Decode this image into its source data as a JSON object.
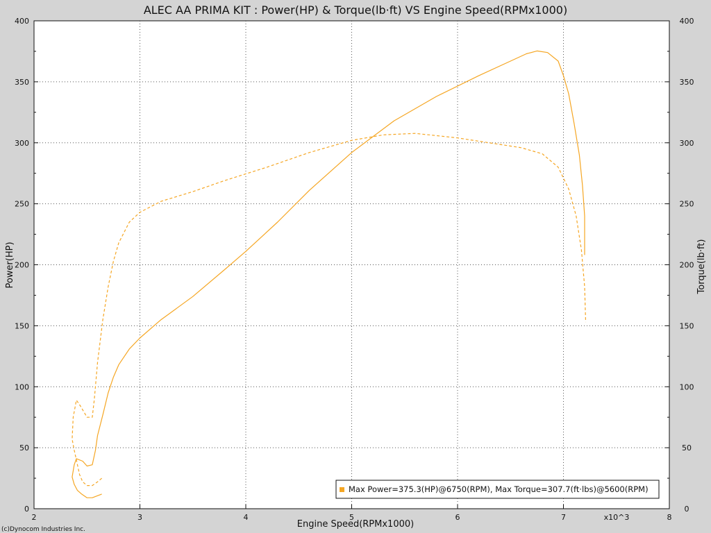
{
  "chart_data": {
    "type": "line",
    "title": "ALEC AA PRIMA KIT : Power(HP) & Torque(lb·ft) VS Engine Speed(RPMx1000)",
    "xlabel": "Engine Speed(RPMx1000)",
    "ylabel": "Power(HP)",
    "y2label": "Torque(lb·ft)",
    "x_multiplier_label": "x10^3",
    "copyright": "(c)Dynocom Industries Inc.",
    "legend_text": "Max Power=375.3(HP)@6750(RPM), Max Torque=307.7(ft·lbs)@5600(RPM)",
    "xlim": [
      2,
      8
    ],
    "ylim": [
      0,
      400
    ],
    "y2lim": [
      0,
      400
    ],
    "x_ticks": [
      "2",
      "3",
      "4",
      "5",
      "6",
      "7",
      "8"
    ],
    "y_ticks": [
      "0",
      "50",
      "100",
      "150",
      "200",
      "250",
      "300",
      "350",
      "400"
    ],
    "y2_ticks": [
      "0",
      "50",
      "100",
      "150",
      "200",
      "250",
      "300",
      "350",
      "400"
    ],
    "grid": true,
    "line_color": "#f5a623",
    "series": [
      {
        "style": "solid",
        "points": [
          [
            2.64,
            12
          ],
          [
            2.55,
            9
          ],
          [
            2.5,
            9
          ],
          [
            2.45,
            12
          ],
          [
            2.41,
            15
          ],
          [
            2.38,
            20
          ],
          [
            2.36,
            26
          ],
          [
            2.38,
            36
          ],
          [
            2.4,
            41
          ],
          [
            2.46,
            39
          ],
          [
            2.5,
            35
          ],
          [
            2.55,
            36
          ],
          [
            2.58,
            48
          ],
          [
            2.6,
            60
          ],
          [
            2.65,
            77
          ],
          [
            2.7,
            95
          ],
          [
            2.75,
            108
          ],
          [
            2.8,
            118
          ],
          [
            2.9,
            131
          ],
          [
            3.0,
            140
          ],
          [
            3.2,
            155
          ],
          [
            3.5,
            174
          ],
          [
            3.8,
            196
          ],
          [
            4.0,
            211
          ],
          [
            4.3,
            235
          ],
          [
            4.6,
            261
          ],
          [
            5.0,
            292
          ],
          [
            5.4,
            318
          ],
          [
            5.8,
            338
          ],
          [
            6.2,
            355
          ],
          [
            6.5,
            367
          ],
          [
            6.65,
            373
          ],
          [
            6.75,
            375.3
          ],
          [
            6.85,
            374
          ],
          [
            6.95,
            367
          ],
          [
            7.0,
            355
          ],
          [
            7.05,
            340
          ],
          [
            7.1,
            316
          ],
          [
            7.15,
            290
          ],
          [
            7.18,
            265
          ],
          [
            7.2,
            240
          ],
          [
            7.2,
            208
          ]
        ]
      },
      {
        "style": "dashed",
        "points": [
          [
            2.64,
            25
          ],
          [
            2.6,
            22
          ],
          [
            2.55,
            19
          ],
          [
            2.5,
            19
          ],
          [
            2.46,
            22
          ],
          [
            2.43,
            28
          ],
          [
            2.4,
            40
          ],
          [
            2.38,
            48
          ],
          [
            2.36,
            57
          ],
          [
            2.37,
            75
          ],
          [
            2.4,
            89
          ],
          [
            2.44,
            84
          ],
          [
            2.5,
            75
          ],
          [
            2.55,
            75
          ],
          [
            2.57,
            90
          ],
          [
            2.6,
            120
          ],
          [
            2.65,
            155
          ],
          [
            2.7,
            182
          ],
          [
            2.75,
            203
          ],
          [
            2.8,
            218
          ],
          [
            2.9,
            235
          ],
          [
            3.0,
            243
          ],
          [
            3.2,
            252
          ],
          [
            3.5,
            260
          ],
          [
            3.8,
            269
          ],
          [
            4.2,
            280
          ],
          [
            4.6,
            292
          ],
          [
            5.0,
            302
          ],
          [
            5.3,
            306.5
          ],
          [
            5.6,
            307.7
          ],
          [
            6.0,
            304
          ],
          [
            6.3,
            300
          ],
          [
            6.6,
            296
          ],
          [
            6.8,
            291
          ],
          [
            6.95,
            280
          ],
          [
            7.05,
            262
          ],
          [
            7.12,
            240
          ],
          [
            7.17,
            212
          ],
          [
            7.2,
            182
          ],
          [
            7.21,
            153
          ]
        ]
      }
    ]
  }
}
